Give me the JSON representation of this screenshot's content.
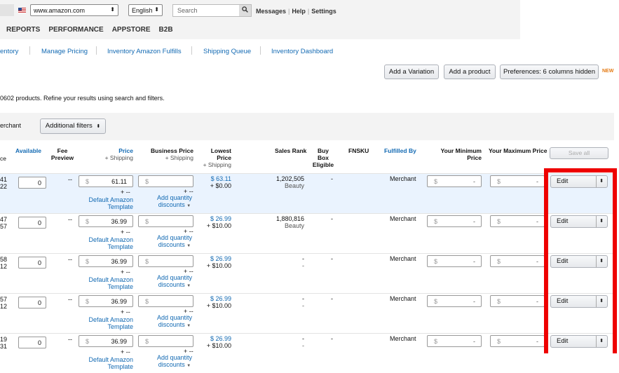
{
  "header": {
    "marketplace": "www.amazon.com",
    "language": "English",
    "search_placeholder": "Search",
    "links": [
      "Messages",
      "Help",
      "Settings"
    ]
  },
  "nav": [
    "REPORTS",
    "PERFORMANCE",
    "APPSTORE",
    "B2B"
  ],
  "subnav": [
    "entory",
    "Manage Pricing",
    "Inventory Amazon Fulfills",
    "Shipping Queue",
    "Inventory Dashboard"
  ],
  "actions": {
    "add_variation": "Add a Variation",
    "add_product": "Add a product",
    "preferences": "Preferences: 6 columns hidden",
    "new_badge": "NEW"
  },
  "count_text": "0602 products. Refine your results using search and filters.",
  "filters": {
    "merchant": "erchant",
    "additional": "Additional filters"
  },
  "columns": {
    "ce": "ce",
    "available": "Available",
    "fee_preview": "Fee\nPreview",
    "price": "Price",
    "price_sub": "+ Shipping",
    "business_price": "Business Price",
    "business_sub": "+ Shipping",
    "lowest1": "Lowest",
    "lowest2": "Price",
    "lowest_sub": "+ Shipping",
    "sales_rank": "Sales Rank",
    "buybox1": "Buy Box",
    "buybox2": "Eligible",
    "fnsku": "FNSKU",
    "fulfilled_by": "Fulfilled By",
    "min1": "Your Minimum",
    "min2": "Price",
    "max": "Your Maximum Price",
    "save_all": "Save all"
  },
  "common": {
    "dollar": "$",
    "dash": "-",
    "dashdash": "--",
    "plusdash": "+ --",
    "template1": "Default Amazon",
    "template2": "Template",
    "qty1": "Add quantity",
    "qty2": "discounts",
    "edit": "Edit",
    "merchant": "Merchant"
  },
  "rows": [
    {
      "c1": "41",
      "c2": "22",
      "available": "0",
      "price": "61.11",
      "lowest": "$ 63.11",
      "lowest_ship": "+ $0.00",
      "rank": "1,202,505",
      "category": "Beauty",
      "fulfilled": "Merchant"
    },
    {
      "c1": "47",
      "c2": "57",
      "available": "0",
      "price": "36.99",
      "lowest": "$ 26.99",
      "lowest_ship": "+ $10.00",
      "rank": "1,880,816",
      "category": "Beauty",
      "fulfilled": "Merchant"
    },
    {
      "c1": "58",
      "c2": "12",
      "available": "0",
      "price": "36.99",
      "lowest": "$ 26.99",
      "lowest_ship": "+ $10.00",
      "rank": "-",
      "category": "-",
      "fulfilled": "Merchant"
    },
    {
      "c1": "57",
      "c2": "12",
      "available": "0",
      "price": "36.99",
      "lowest": "$ 26.99",
      "lowest_ship": "+ $10.00",
      "rank": "-",
      "category": "-",
      "fulfilled": "Merchant"
    },
    {
      "c1": "19",
      "c2": "31",
      "available": "0",
      "price": "36.99",
      "lowest": "$ 26.99",
      "lowest_ship": "+ $10.00",
      "rank": "-",
      "category": "-",
      "fulfilled": "Merchant"
    }
  ]
}
